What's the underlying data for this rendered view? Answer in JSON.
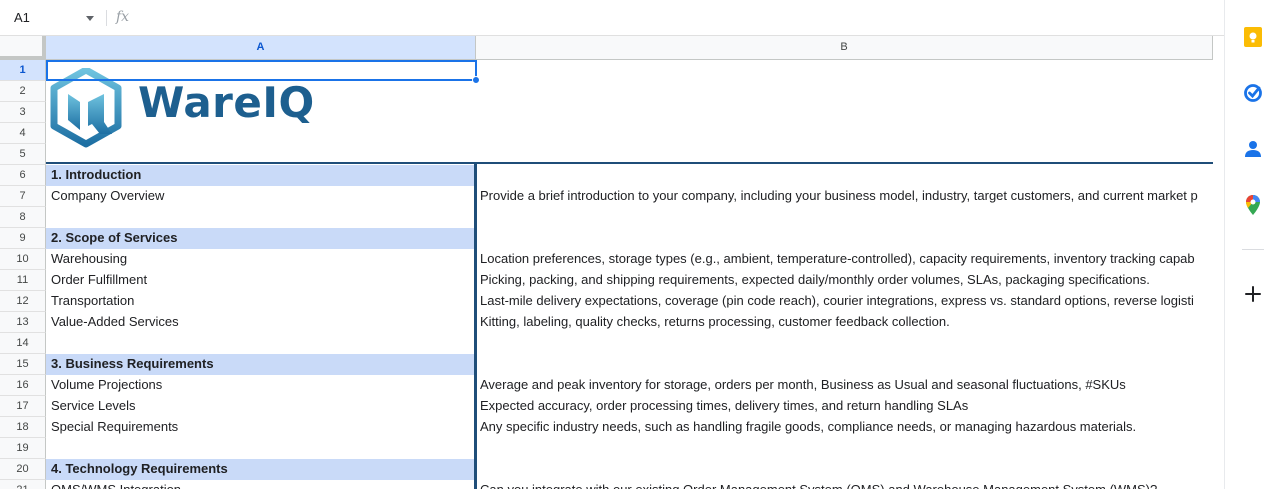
{
  "formula_bar": {
    "name_box": "A1",
    "fx_label": "fx",
    "formula_value": ""
  },
  "columns": [
    "A",
    "B"
  ],
  "rows": [
    "1",
    "2",
    "3",
    "4",
    "5",
    "6",
    "7",
    "8",
    "9",
    "10",
    "11",
    "12",
    "13",
    "14",
    "15",
    "16",
    "17",
    "18",
    "19",
    "20",
    "21"
  ],
  "logo": {
    "text": "WareIQ",
    "color": "#1d5f8f"
  },
  "cells": [
    {
      "a": "",
      "b": ""
    },
    {
      "a": "",
      "b": ""
    },
    {
      "a": "",
      "b": ""
    },
    {
      "a": "",
      "b": ""
    },
    {
      "a": "",
      "b": ""
    },
    {
      "a": "1. Introduction",
      "b": "",
      "section": true
    },
    {
      "a": "Company Overview",
      "b": "Provide a brief introduction to your company, including your business model, industry, target customers, and current market p"
    },
    {
      "a": "",
      "b": ""
    },
    {
      "a": "2. Scope of Services",
      "b": "",
      "section": true
    },
    {
      "a": "Warehousing",
      "b": "Location preferences, storage types (e.g., ambient, temperature-controlled), capacity requirements, inventory tracking capab"
    },
    {
      "a": "Order Fulfillment",
      "b": "Picking, packing, and shipping requirements, expected daily/monthly order volumes, SLAs, packaging specifications."
    },
    {
      "a": "Transportation",
      "b": "Last-mile delivery expectations, coverage (pin code reach), courier integrations, express vs. standard options, reverse logisti"
    },
    {
      "a": "Value-Added Services",
      "b": "Kitting, labeling, quality checks, returns processing, customer feedback collection."
    },
    {
      "a": "",
      "b": ""
    },
    {
      "a": "3. Business Requirements",
      "b": "",
      "section": true
    },
    {
      "a": "Volume Projections",
      "b": "Average and peak inventory for storage, orders per month, Business as Usual and seasonal fluctuations, #SKUs"
    },
    {
      "a": "Service Levels",
      "b": "Expected accuracy, order processing times, delivery times, and return handling SLAs"
    },
    {
      "a": "Special Requirements",
      "b": "Any specific industry needs, such as handling fragile goods, compliance needs, or managing hazardous materials."
    },
    {
      "a": "",
      "b": ""
    },
    {
      "a": "4. Technology Requirements",
      "b": "",
      "section": true
    },
    {
      "a": "OMS/WMS Integration",
      "b": "Can you integrate with our existing Order Management System (OMS) and Warehouse Management System (WMS)?"
    }
  ],
  "side_panel": {
    "icons": [
      "keep-icon",
      "tasks-icon",
      "contacts-icon",
      "maps-icon",
      "add-icon"
    ],
    "colors": {
      "keep": "#fbbc04",
      "tasks": "#1a73e8",
      "contacts": "#1a73e8"
    }
  },
  "colors": {
    "section_fill": "#c9daf8",
    "border_dark": "#1f4e79",
    "selection": "#1a73e8"
  }
}
